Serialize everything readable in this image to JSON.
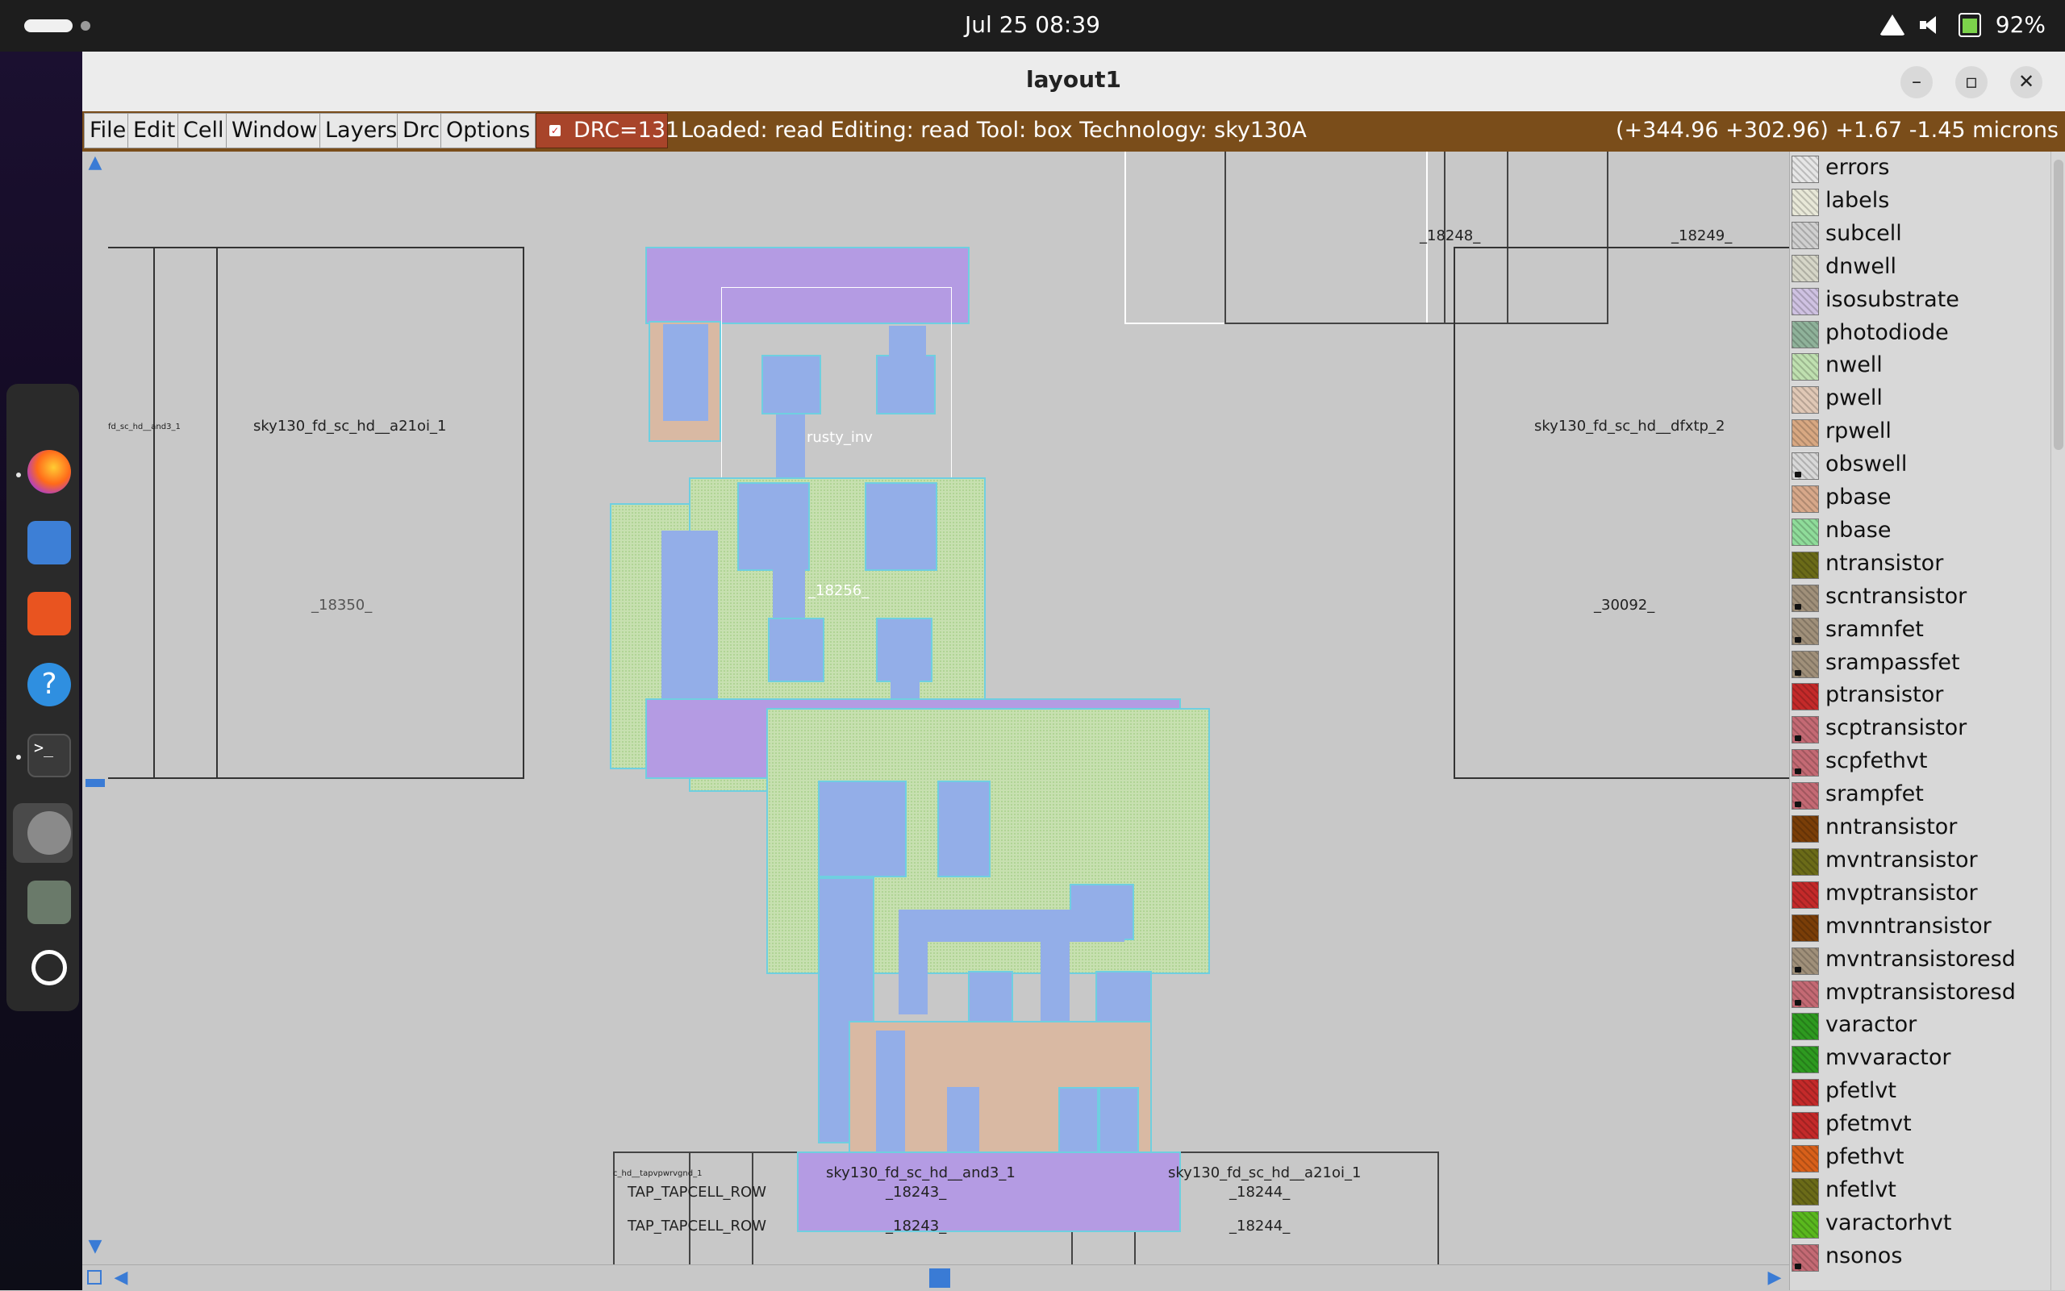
{
  "topbar": {
    "clock": "Jul 25  08:39",
    "battery": "92%"
  },
  "dock": {
    "items": [
      "firefox-icon",
      "files-icon",
      "app-center-icon",
      "help-icon",
      "terminal-icon",
      "settings-icon",
      "trash-icon",
      "ubuntu-icon"
    ]
  },
  "window": {
    "title": "layout1"
  },
  "menubar": {
    "items": [
      "File",
      "Edit",
      "Cell",
      "Window",
      "Layers",
      "Drc",
      "Options"
    ],
    "drc": "DRC=131",
    "status": "Loaded: read Editing: read Tool: box  Technology: sky130A",
    "coords": "(+344.96 +302.96) +1.67 -1.45 microns"
  },
  "canvas": {
    "labels": {
      "and3_small": "fd_sc_hd__and3_1",
      "a21oi_top": "sky130_fd_sc_hd__a21oi_1",
      "id_18350": "_18350_",
      "rusty": "rusty_inv",
      "id_18256": "_18256_",
      "id_18248": "_18248_",
      "id_18249": "_18249_",
      "dfxtp": "sky130_fd_sc_hd__dfxtp_2",
      "id_30092": "_30092_",
      "tap_small": "c_hd__tapvpwrvgnd_1",
      "tap1": "TAP_TAPCELL_ROW",
      "tap2": "TAP_TAPCELL_ROW",
      "and3_bottom": "sky130_fd_sc_hd__and3_1",
      "id_18243_a": "_18243_",
      "id_18243_b": "_18243_",
      "a21oi_bottom": "sky130_fd_sc_hd__a21oi_1",
      "id_18244_a": "_18244_",
      "id_18244_b": "_18244_"
    }
  },
  "layers": [
    {
      "name": "errors",
      "color": "#e6e6e6",
      "locked": false
    },
    {
      "name": "labels",
      "color": "#e8e8d8",
      "locked": false
    },
    {
      "name": "subcell",
      "color": "#d0d0d0",
      "locked": false
    },
    {
      "name": "dnwell",
      "color": "#d6d6c8",
      "locked": false
    },
    {
      "name": "isosubstrate",
      "color": "#cfc2e2",
      "locked": false
    },
    {
      "name": "photodiode",
      "color": "#8fb29a",
      "locked": false
    },
    {
      "name": "nwell",
      "color": "#bfe0b0",
      "locked": false
    },
    {
      "name": "pwell",
      "color": "#e0c8b6",
      "locked": false
    },
    {
      "name": "rpwell",
      "color": "#d8a882",
      "locked": false
    },
    {
      "name": "obswell",
      "color": "#d8d8d8",
      "locked": true
    },
    {
      "name": "pbase",
      "color": "#d7a88a",
      "locked": false
    },
    {
      "name": "nbase",
      "color": "#8fdc9a",
      "locked": false
    },
    {
      "name": "ntransistor",
      "color": "#6b6b18",
      "locked": false
    },
    {
      "name": "scntransistor",
      "color": "#a0907a",
      "locked": true
    },
    {
      "name": "sramnfet",
      "color": "#a0907a",
      "locked": true
    },
    {
      "name": "srampassfet",
      "color": "#a0907a",
      "locked": true
    },
    {
      "name": "ptransistor",
      "color": "#c42a2a",
      "locked": false
    },
    {
      "name": "scptransistor",
      "color": "#c46a74",
      "locked": true
    },
    {
      "name": "scpfethvt",
      "color": "#c46a74",
      "locked": true
    },
    {
      "name": "srampfet",
      "color": "#c46a74",
      "locked": true
    },
    {
      "name": "nntransistor",
      "color": "#7a3e08",
      "locked": false
    },
    {
      "name": "mvntransistor",
      "color": "#6b6b18",
      "locked": false
    },
    {
      "name": "mvptransistor",
      "color": "#c42a2a",
      "locked": false
    },
    {
      "name": "mvnntransistor",
      "color": "#7a3e08",
      "locked": false
    },
    {
      "name": "mvntransistoresd",
      "color": "#a0907a",
      "locked": true
    },
    {
      "name": "mvptransistoresd",
      "color": "#c46a74",
      "locked": true
    },
    {
      "name": "varactor",
      "color": "#2e9a20",
      "locked": false
    },
    {
      "name": "mvvaractor",
      "color": "#2e9a20",
      "locked": false
    },
    {
      "name": "pfetlvt",
      "color": "#c42a2a",
      "locked": false
    },
    {
      "name": "pfetmvt",
      "color": "#c42a2a",
      "locked": false
    },
    {
      "name": "pfethvt",
      "color": "#d8601a",
      "locked": false
    },
    {
      "name": "nfetlvt",
      "color": "#6b6b18",
      "locked": false
    },
    {
      "name": "varactorhvt",
      "color": "#5ab81e",
      "locked": false
    },
    {
      "name": "nsonos",
      "color": "#c46a74",
      "locked": true
    }
  ]
}
